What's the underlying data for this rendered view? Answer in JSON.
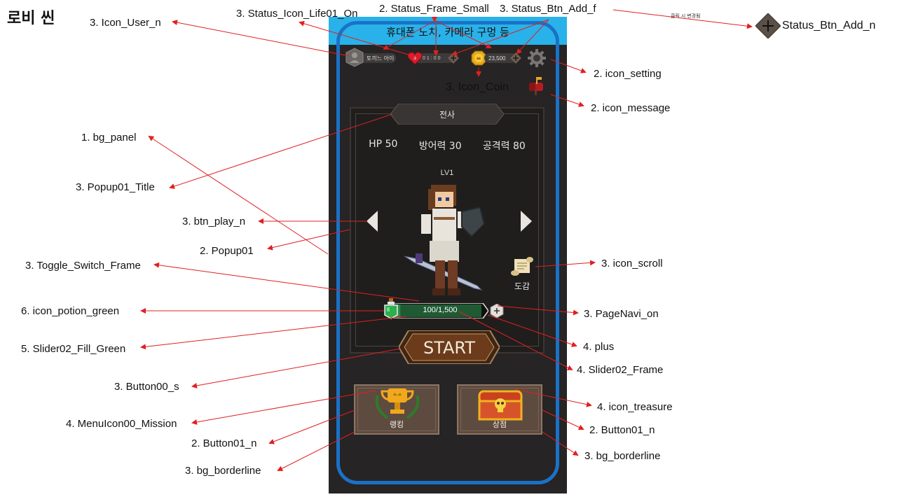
{
  "scene_title": "로비 씬",
  "tiny_note": "클릭 시 변경됨",
  "phone": {
    "notch_text": "휴대폰 노치, 카메라 구멍 등",
    "status_bar": {
      "user_name": "토끼느 아이",
      "life_count": "3",
      "life_timer": "01:00",
      "coin_value": "23,500"
    },
    "popup": {
      "title": "전사",
      "stats": {
        "hp": "HP 50",
        "defense": "방어력 30",
        "attack": "공격력 80"
      },
      "level": "LV1",
      "scroll_label": "도감",
      "exp_text": "100/1,500",
      "exp_fraction": 0.067
    },
    "start_label": "START",
    "menu": [
      {
        "label": "랭킹",
        "icon": "trophy-icon"
      },
      {
        "label": "상점",
        "icon": "treasure-chest-icon"
      }
    ]
  },
  "annotations": [
    {
      "id": "status_btn_add_n",
      "text": "Status_Btn_Add_n"
    },
    {
      "id": "status_frame_small",
      "text": "2. Status_Frame_Small"
    },
    {
      "id": "status_btn_add_f",
      "text": "3. Status_Btn_Add_f"
    },
    {
      "id": "status_icon_life",
      "text": "3. Status_Icon_Life01_On"
    },
    {
      "id": "icon_user",
      "text": "3. Icon_User_n"
    },
    {
      "id": "icon_setting",
      "text": "2. icon_setting"
    },
    {
      "id": "icon_coin",
      "text": "3. Icon_Coin"
    },
    {
      "id": "icon_message",
      "text": "2. icon_message"
    },
    {
      "id": "bg_panel",
      "text": "1. bg_panel"
    },
    {
      "id": "popup01_title",
      "text": "3. Popup01_Title"
    },
    {
      "id": "btn_play",
      "text": "3. btn_play_n"
    },
    {
      "id": "popup01",
      "text": "2. Popup01"
    },
    {
      "id": "toggle_switch_frame",
      "text": "3. Toggle_Switch_Frame"
    },
    {
      "id": "icon_scroll",
      "text": "3. icon_scroll"
    },
    {
      "id": "icon_potion",
      "text": "6. icon_potion_green"
    },
    {
      "id": "page_navi",
      "text": "3. PageNavi_on"
    },
    {
      "id": "slider_fill",
      "text": "5. Slider02_Fill_Green"
    },
    {
      "id": "plus",
      "text": "4. plus"
    },
    {
      "id": "slider_frame",
      "text": "4. Slider02_Frame"
    },
    {
      "id": "button00",
      "text": "3. Button00_s"
    },
    {
      "id": "icon_treasure",
      "text": "4. icon_treasure"
    },
    {
      "id": "menu_mission",
      "text": "4. MenuIcon00_Mission"
    },
    {
      "id": "button01_right",
      "text": "2. Button01_n"
    },
    {
      "id": "button01_left",
      "text": "2. Button01_n"
    },
    {
      "id": "bg_borderline_right",
      "text": "3. bg_borderline"
    },
    {
      "id": "bg_borderline_left",
      "text": "3. bg_borderline"
    }
  ],
  "colors": {
    "accent_line": "#e02020",
    "notch": "#29b2e9",
    "safe_frame": "#1a72c7",
    "panel_bg": "#262424",
    "slider_fill": "#2e8a4a"
  }
}
